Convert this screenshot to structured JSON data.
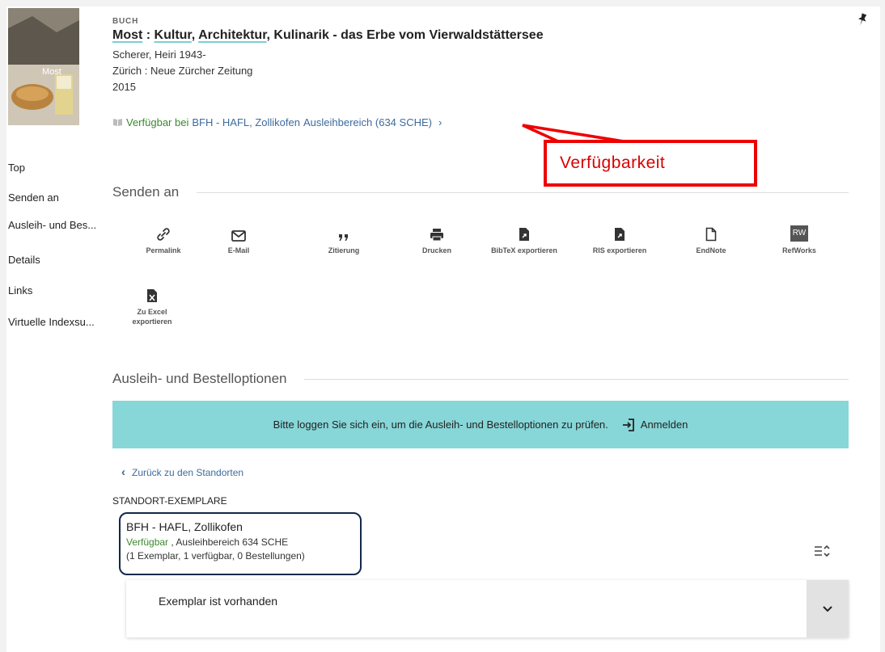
{
  "record": {
    "type": "BUCH",
    "title_part1": "Most",
    "title_sep": " : ",
    "title_part2": "Kultur",
    "title_comma": ", ",
    "title_part3": "Architektur",
    "title_rest": ", Kulinarik - das Erbe vom Vierwaldstättersee",
    "author": "Scherer, Heiri 1943-",
    "publisher": "Zürich : Neue Zürcher Zeitung",
    "year": "2015",
    "availability_status": "Verfügbar bei",
    "availability_location": "BFH - HAFL, Zollikofen",
    "availability_shelf": "Ausleihbereich (634 SCHE)",
    "thumbnail_text": "Most"
  },
  "nav": {
    "items": [
      {
        "label": "Top"
      },
      {
        "label": "Senden an"
      },
      {
        "label": "Ausleih- und Bes..."
      },
      {
        "label": "Details"
      },
      {
        "label": "Links"
      },
      {
        "label": "Virtuelle Indexsu..."
      }
    ]
  },
  "send_to": {
    "title": "Senden an",
    "actions": [
      {
        "label": "Permalink",
        "icon": "link-icon"
      },
      {
        "label": "E-Mail",
        "icon": "mail-icon"
      },
      {
        "label": "Zitierung",
        "icon": "quote-icon"
      },
      {
        "label": "Drucken",
        "icon": "print-icon"
      },
      {
        "label": "BibTeX exportieren",
        "icon": "export-file-icon"
      },
      {
        "label": "RIS exportieren",
        "icon": "export-file-icon"
      },
      {
        "label": "EndNote",
        "icon": "file-icon"
      },
      {
        "label": "RefWorks",
        "icon": "refworks-icon",
        "badge": "RW"
      },
      {
        "label": "Zu Excel exportieren",
        "icon": "excel-icon"
      }
    ]
  },
  "loan": {
    "title": "Ausleih- und Bestelloptionen",
    "banner_text": "Bitte loggen Sie sich ein, um die Ausleih- und Bestelloptionen zu prüfen.",
    "login_label": "Anmelden",
    "back_label": "Zurück zu den Standorten",
    "locations_label": "STANDORT-EXEMPLARE",
    "location_name": "BFH - HAFL, Zollikofen",
    "location_status": "Verfügbar",
    "location_shelf": " , Ausleihbereich 634 SCHE",
    "location_counts": "(1 Exemplar, 1 verfügbar, 0 Bestellungen)",
    "item_text": "Exemplar ist vorhanden"
  },
  "annotation": {
    "label": "Verfügbarkeit",
    "color": "#ee0000"
  },
  "colors": {
    "available_green": "#3a8a2c",
    "link_blue": "#3d6b9e",
    "banner_teal": "#87d6d8",
    "highlight_navy": "#12284a"
  }
}
